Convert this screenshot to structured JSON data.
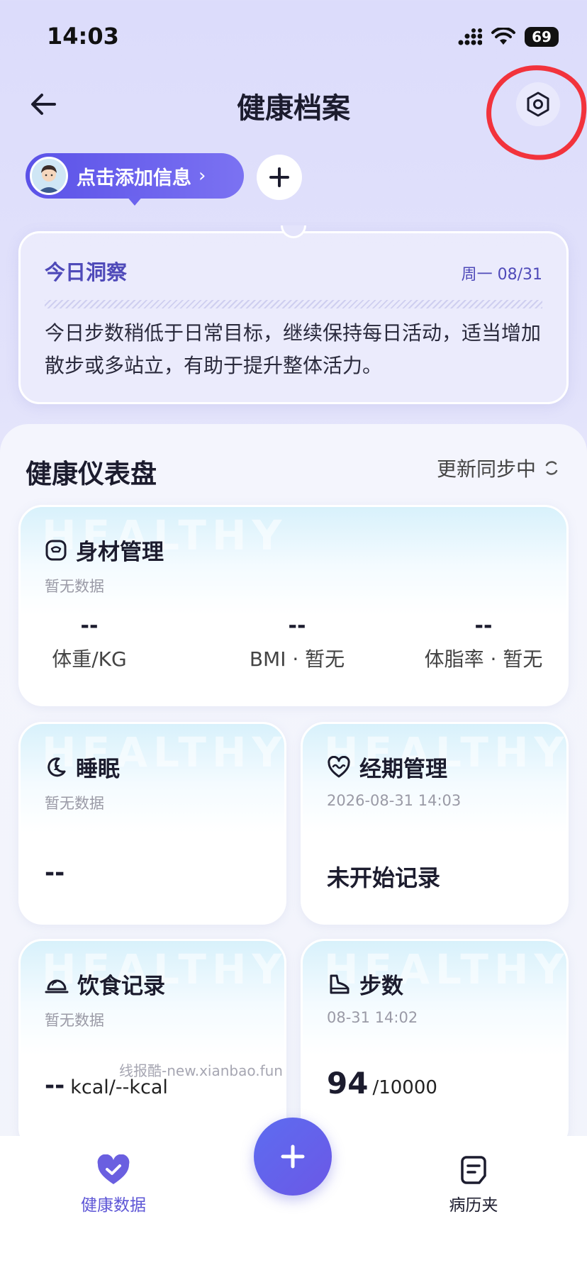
{
  "status_bar": {
    "time": "14:03",
    "battery": "69"
  },
  "header": {
    "title": "健康档案"
  },
  "profile": {
    "label": "点击添加信息",
    "chevron": "›"
  },
  "insight": {
    "title": "今日洞察",
    "date": "周一 08/31",
    "text": "今日步数稍低于日常目标，继续保持每日活动，适当增加散步或多站立，有助于提升整体活力。"
  },
  "dashboard": {
    "title": "健康仪表盘",
    "sync": "更新同步中",
    "watermark": "HEALTHY",
    "body": {
      "title": "身材管理",
      "sub": "暂无数据",
      "metrics": [
        {
          "value": "--",
          "label": "体重/KG"
        },
        {
          "value": "--",
          "label": "BMI · 暂无"
        },
        {
          "value": "--",
          "label": "体脂率 · 暂无"
        }
      ]
    },
    "sleep": {
      "title": "睡眠",
      "sub": "暂无数据",
      "value": "--"
    },
    "period": {
      "title": "经期管理",
      "sub": "2026-08-31 14:03",
      "value": "未开始记录"
    },
    "diet": {
      "title": "饮食记录",
      "sub": "暂无数据",
      "value": "--",
      "unit": "kcal/--kcal"
    },
    "steps": {
      "title": "步数",
      "sub": "08-31 14:02",
      "value": "94",
      "goal": "/10000"
    }
  },
  "site_watermark": "线报酷-new.xianbao.fun",
  "bottom_nav": {
    "tabs": [
      {
        "label": "健康数据",
        "icon": "heart-check-icon",
        "active": true
      },
      {
        "label": "病历夹",
        "icon": "folder-icon",
        "active": false
      }
    ],
    "fab_icon": "plus-icon"
  },
  "colors": {
    "accent": "#5d56d6",
    "annotation": "#f2333c"
  }
}
